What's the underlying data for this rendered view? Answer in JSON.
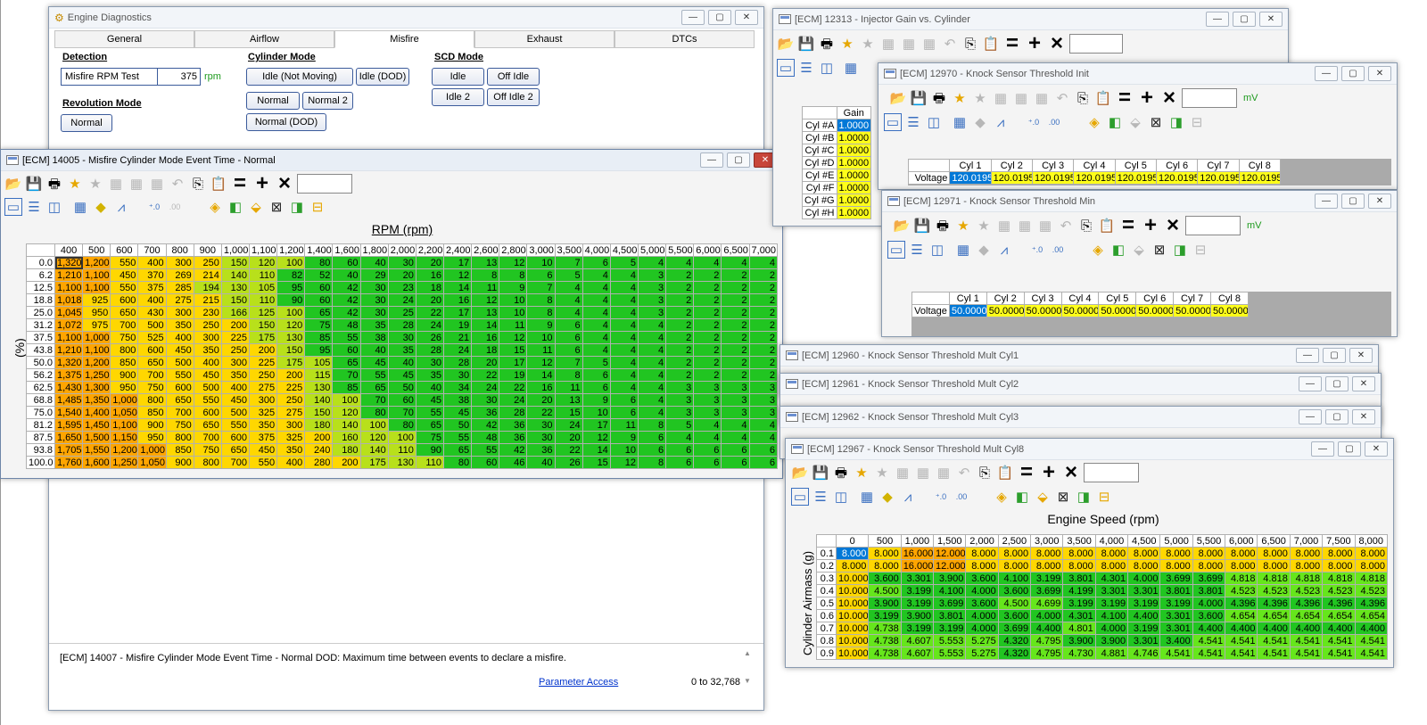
{
  "main": {
    "title": "Engine Diagnostics",
    "tabs": [
      "General",
      "Airflow",
      "Misfire",
      "Exhaust",
      "DTCs"
    ],
    "active_tab": 2,
    "detection": {
      "header": "Detection",
      "label": "Misfire RPM Test",
      "value": "375",
      "unit": "rpm"
    },
    "revolution": {
      "header": "Revolution Mode",
      "button": "Normal"
    },
    "cylinder": {
      "header": "Cylinder Mode",
      "buttons": [
        "Idle (Not Moving)",
        "Idle (DOD)",
        "Normal",
        "Normal 2",
        "Normal (DOD)"
      ]
    },
    "scd": {
      "header": "SCD Mode",
      "buttons": [
        "Idle",
        "Off Idle",
        "Idle 2",
        "Off Idle 2"
      ]
    },
    "description": "[ECM] 14007 - Misfire Cylinder Mode Event Time - Normal DOD: Maximum time between events to declare a misfire.",
    "link": "Parameter Access",
    "range": "0 to 32,768"
  },
  "misfire": {
    "title": "[ECM] 14005 - Misfire Cylinder Mode Event Time - Normal",
    "x_axis": "RPM (rpm)",
    "y_axis": "(%)",
    "cols": [
      "400",
      "500",
      "600",
      "700",
      "800",
      "900",
      "1,000",
      "1,100",
      "1,200",
      "1,400",
      "1,600",
      "1,800",
      "2,000",
      "2,200",
      "2,400",
      "2,600",
      "2,800",
      "3,000",
      "3,500",
      "4,000",
      "4,500",
      "5,000",
      "5,500",
      "6,000",
      "6,500",
      "7,000"
    ],
    "rows": [
      "0.0",
      "6.2",
      "12.5",
      "18.8",
      "25.0",
      "31.2",
      "37.5",
      "43.8",
      "50.0",
      "56.2",
      "62.5",
      "68.8",
      "75.0",
      "81.2",
      "87.5",
      "93.8",
      "100.0"
    ],
    "data": [
      [
        "1,320",
        "1,200",
        "550",
        "400",
        "300",
        "250",
        "150",
        "120",
        "100",
        "80",
        "60",
        "40",
        "30",
        "20",
        "17",
        "13",
        "12",
        "10",
        "7",
        "6",
        "5",
        "4",
        "4",
        "4",
        "4",
        "4"
      ],
      [
        "1,210",
        "1,100",
        "450",
        "370",
        "269",
        "214",
        "140",
        "110",
        "82",
        "52",
        "40",
        "29",
        "20",
        "16",
        "12",
        "8",
        "8",
        "6",
        "5",
        "4",
        "4",
        "3",
        "2",
        "2",
        "2",
        "2"
      ],
      [
        "1,100",
        "1,100",
        "550",
        "375",
        "285",
        "194",
        "130",
        "105",
        "95",
        "60",
        "42",
        "30",
        "23",
        "18",
        "14",
        "11",
        "9",
        "7",
        "4",
        "4",
        "4",
        "3",
        "2",
        "2",
        "2",
        "2"
      ],
      [
        "1,018",
        "925",
        "600",
        "400",
        "275",
        "215",
        "150",
        "110",
        "90",
        "60",
        "42",
        "30",
        "24",
        "20",
        "16",
        "12",
        "10",
        "8",
        "4",
        "4",
        "4",
        "3",
        "2",
        "2",
        "2",
        "2"
      ],
      [
        "1,045",
        "950",
        "650",
        "430",
        "300",
        "230",
        "166",
        "125",
        "100",
        "65",
        "42",
        "30",
        "25",
        "22",
        "17",
        "13",
        "10",
        "8",
        "4",
        "4",
        "4",
        "3",
        "2",
        "2",
        "2",
        "2"
      ],
      [
        "1,072",
        "975",
        "700",
        "500",
        "350",
        "250",
        "200",
        "150",
        "120",
        "75",
        "48",
        "35",
        "28",
        "24",
        "19",
        "14",
        "11",
        "9",
        "6",
        "4",
        "4",
        "4",
        "2",
        "2",
        "2",
        "2"
      ],
      [
        "1,100",
        "1,000",
        "750",
        "525",
        "400",
        "300",
        "225",
        "175",
        "130",
        "85",
        "55",
        "38",
        "30",
        "26",
        "21",
        "16",
        "12",
        "10",
        "6",
        "4",
        "4",
        "4",
        "2",
        "2",
        "2",
        "2"
      ],
      [
        "1,210",
        "1,100",
        "800",
        "600",
        "450",
        "350",
        "250",
        "200",
        "150",
        "95",
        "60",
        "40",
        "35",
        "28",
        "24",
        "18",
        "15",
        "11",
        "6",
        "4",
        "4",
        "4",
        "2",
        "2",
        "2",
        "2"
      ],
      [
        "1,320",
        "1,200",
        "850",
        "650",
        "500",
        "400",
        "300",
        "225",
        "175",
        "105",
        "65",
        "45",
        "40",
        "30",
        "28",
        "20",
        "17",
        "12",
        "7",
        "5",
        "4",
        "4",
        "2",
        "2",
        "2",
        "2"
      ],
      [
        "1,375",
        "1,250",
        "900",
        "700",
        "550",
        "450",
        "350",
        "250",
        "200",
        "115",
        "70",
        "55",
        "45",
        "35",
        "30",
        "22",
        "19",
        "14",
        "8",
        "6",
        "4",
        "4",
        "2",
        "2",
        "2",
        "2"
      ],
      [
        "1,430",
        "1,300",
        "950",
        "750",
        "600",
        "500",
        "400",
        "275",
        "225",
        "130",
        "85",
        "65",
        "50",
        "40",
        "34",
        "24",
        "22",
        "16",
        "11",
        "6",
        "4",
        "4",
        "3",
        "3",
        "3",
        "3"
      ],
      [
        "1,485",
        "1,350",
        "1,000",
        "800",
        "650",
        "550",
        "450",
        "300",
        "250",
        "140",
        "100",
        "70",
        "60",
        "45",
        "38",
        "30",
        "24",
        "20",
        "13",
        "9",
        "6",
        "4",
        "3",
        "3",
        "3",
        "3"
      ],
      [
        "1,540",
        "1,400",
        "1,050",
        "850",
        "700",
        "600",
        "500",
        "325",
        "275",
        "150",
        "120",
        "80",
        "70",
        "55",
        "45",
        "36",
        "28",
        "22",
        "15",
        "10",
        "6",
        "4",
        "3",
        "3",
        "3",
        "3"
      ],
      [
        "1,595",
        "1,450",
        "1,100",
        "900",
        "750",
        "650",
        "550",
        "350",
        "300",
        "180",
        "140",
        "100",
        "80",
        "65",
        "50",
        "42",
        "36",
        "30",
        "24",
        "17",
        "11",
        "8",
        "5",
        "4",
        "4",
        "4"
      ],
      [
        "1,650",
        "1,500",
        "1,150",
        "950",
        "800",
        "700",
        "600",
        "375",
        "325",
        "200",
        "160",
        "120",
        "100",
        "75",
        "55",
        "48",
        "36",
        "30",
        "20",
        "12",
        "9",
        "6",
        "4",
        "4",
        "4",
        "4"
      ],
      [
        "1,705",
        "1,550",
        "1,200",
        "1,000",
        "850",
        "750",
        "650",
        "450",
        "350",
        "240",
        "180",
        "140",
        "110",
        "90",
        "65",
        "55",
        "42",
        "36",
        "22",
        "14",
        "10",
        "6",
        "6",
        "6",
        "6",
        "6"
      ],
      [
        "1,760",
        "1,600",
        "1,250",
        "1,050",
        "900",
        "800",
        "700",
        "550",
        "400",
        "280",
        "200",
        "175",
        "130",
        "110",
        "80",
        "60",
        "46",
        "40",
        "26",
        "15",
        "12",
        "8",
        "6",
        "6",
        "6",
        "6"
      ]
    ]
  },
  "injector": {
    "title": "[ECM] 12313 - Injector Gain vs. Cylinder",
    "header": "Gain",
    "rows": [
      "Cyl #A",
      "Cyl #B",
      "Cyl #C",
      "Cyl #D",
      "Cyl #E",
      "Cyl #F",
      "Cyl #G",
      "Cyl #H"
    ],
    "values": [
      "1.0000",
      "1.0000",
      "1.0000",
      "1.0000",
      "1.0000",
      "1.0000",
      "1.0000",
      "1.0000"
    ]
  },
  "knock_init": {
    "title": "[ECM] 12970 - Knock Sensor Threshold Init",
    "unit": "mV",
    "row": "Voltage",
    "cols": [
      "Cyl 1",
      "Cyl 2",
      "Cyl 3",
      "Cyl 4",
      "Cyl 5",
      "Cyl 6",
      "Cyl 7",
      "Cyl 8"
    ],
    "values": [
      "120.0195",
      "120.0195",
      "120.0195",
      "120.0195",
      "120.0195",
      "120.0195",
      "120.0195",
      "120.0195"
    ]
  },
  "knock_min": {
    "title": "[ECM] 12971 - Knock Sensor Threshold Min",
    "unit": "mV",
    "row": "Voltage",
    "cols": [
      "Cyl 1",
      "Cyl 2",
      "Cyl 3",
      "Cyl 4",
      "Cyl 5",
      "Cyl 6",
      "Cyl 7",
      "Cyl 8"
    ],
    "values": [
      "50.0000",
      "50.0000",
      "50.0000",
      "50.0000",
      "50.0000",
      "50.0000",
      "50.0000",
      "50.0000"
    ]
  },
  "mult1": {
    "title": "[ECM] 12960 - Knock Sensor Threshold Mult Cyl1"
  },
  "mult2": {
    "title": "[ECM] 12961 - Knock Sensor Threshold Mult Cyl2"
  },
  "mult3": {
    "title": "[ECM] 12962 - Knock Sensor Threshold Mult Cyl3"
  },
  "mult8": {
    "title": "[ECM] 12967 - Knock Sensor Threshold Mult Cyl8",
    "x_axis": "Engine Speed (rpm)",
    "y_axis": "Cylinder Airmass (g)",
    "cols": [
      "0",
      "500",
      "1,000",
      "1,500",
      "2,000",
      "2,500",
      "3,000",
      "3,500",
      "4,000",
      "4,500",
      "5,000",
      "5,500",
      "6,000",
      "6,500",
      "7,000",
      "7,500",
      "8,000"
    ],
    "rows": [
      "0.1",
      "0.2",
      "0.3",
      "0.4",
      "0.5",
      "0.6",
      "0.7",
      "0.8",
      "0.9"
    ],
    "data": [
      [
        "8.000",
        "8.000",
        "16.000",
        "12.000",
        "8.000",
        "8.000",
        "8.000",
        "8.000",
        "8.000",
        "8.000",
        "8.000",
        "8.000",
        "8.000",
        "8.000",
        "8.000",
        "8.000",
        "8.000"
      ],
      [
        "8.000",
        "8.000",
        "16.000",
        "12.000",
        "8.000",
        "8.000",
        "8.000",
        "8.000",
        "8.000",
        "8.000",
        "8.000",
        "8.000",
        "8.000",
        "8.000",
        "8.000",
        "8.000",
        "8.000"
      ],
      [
        "10.000",
        "3.600",
        "3.301",
        "3.900",
        "3.600",
        "4.100",
        "3.199",
        "3.801",
        "4.301",
        "4.000",
        "3.699",
        "3.699",
        "4.818",
        "4.818",
        "4.818",
        "4.818",
        "4.818"
      ],
      [
        "10.000",
        "4.500",
        "3.199",
        "4.100",
        "4.000",
        "3.600",
        "3.699",
        "4.199",
        "3.301",
        "3.301",
        "3.801",
        "3.801",
        "4.523",
        "4.523",
        "4.523",
        "4.523",
        "4.523"
      ],
      [
        "10.000",
        "3.900",
        "3.199",
        "3.699",
        "3.600",
        "4.500",
        "4.699",
        "3.199",
        "3.199",
        "3.199",
        "3.199",
        "4.000",
        "4.396",
        "4.396",
        "4.396",
        "4.396",
        "4.396"
      ],
      [
        "10.000",
        "3.199",
        "3.900",
        "3.801",
        "4.000",
        "3.600",
        "4.000",
        "4.301",
        "4.100",
        "4.400",
        "3.301",
        "3.600",
        "4.654",
        "4.654",
        "4.654",
        "4.654",
        "4.654"
      ],
      [
        "10.000",
        "4.738",
        "3.199",
        "3.199",
        "4.000",
        "3.699",
        "4.400",
        "4.801",
        "4.000",
        "3.199",
        "3.301",
        "4.400",
        "4.400",
        "4.400",
        "4.400",
        "4.400",
        "4.400"
      ],
      [
        "10.000",
        "4.738",
        "4.607",
        "5.553",
        "5.275",
        "4.320",
        "4.795",
        "3.900",
        "3.900",
        "3.301",
        "3.400",
        "4.541",
        "4.541",
        "4.541",
        "4.541",
        "4.541",
        "4.541"
      ],
      [
        "10.000",
        "4.738",
        "4.607",
        "5.553",
        "5.275",
        "4.320",
        "4.795",
        "4.730",
        "4.881",
        "4.746",
        "4.541",
        "4.541",
        "4.541",
        "4.541",
        "4.541",
        "4.541",
        "4.541"
      ]
    ]
  }
}
